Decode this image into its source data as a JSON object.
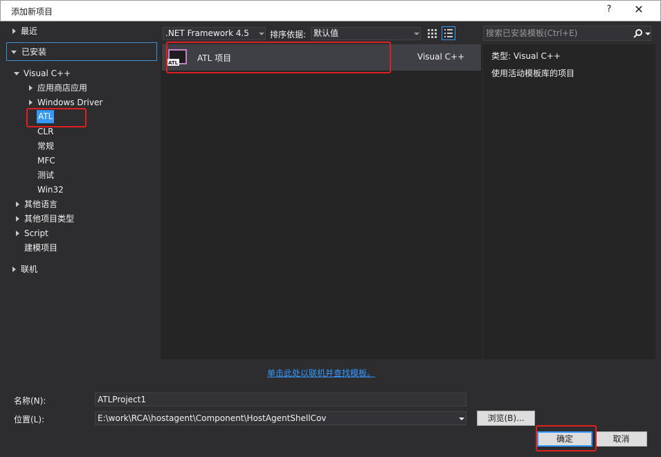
{
  "window": {
    "title": "添加新项目",
    "help": "?",
    "close": "✕"
  },
  "tree": {
    "recent": "最近",
    "installed": "已安装",
    "visual_cpp": "Visual C++",
    "store_apps": "应用商店应用",
    "windows_driver": "Windows Driver",
    "atl": "ATL",
    "clr": "CLR",
    "general": "常规",
    "mfc": "MFC",
    "test": "测试",
    "win32": "Win32",
    "other_languages": "其他语言",
    "other_project_types": "其他项目类型",
    "script": "Script",
    "modeling": "建模项目",
    "online": "联机"
  },
  "toolbar": {
    "framework": ".NET Framework 4.5",
    "sort_label": "排序依据:",
    "sort_value": "默认值"
  },
  "templates": [
    {
      "name": "ATL 项目",
      "language": "Visual C++",
      "icon_text": "ATL"
    }
  ],
  "online_link": "单击此处以联机并查找模板。",
  "search": {
    "placeholder": "搜索已安装模板(Ctrl+E)"
  },
  "details": {
    "type": "类型:  Visual C++",
    "description": "使用活动模板库的项目"
  },
  "form": {
    "name_label": "名称(N):",
    "name_value": "ATLProject1",
    "location_label": "位置(L):",
    "location_value": "E:\\work\\RCA\\hostagent\\Component\\HostAgentShellCov",
    "browse": "浏览(B)...",
    "ok": "确定",
    "cancel": "取消"
  },
  "colors": {
    "accent": "#3399ff",
    "highlight": "#e02020"
  }
}
